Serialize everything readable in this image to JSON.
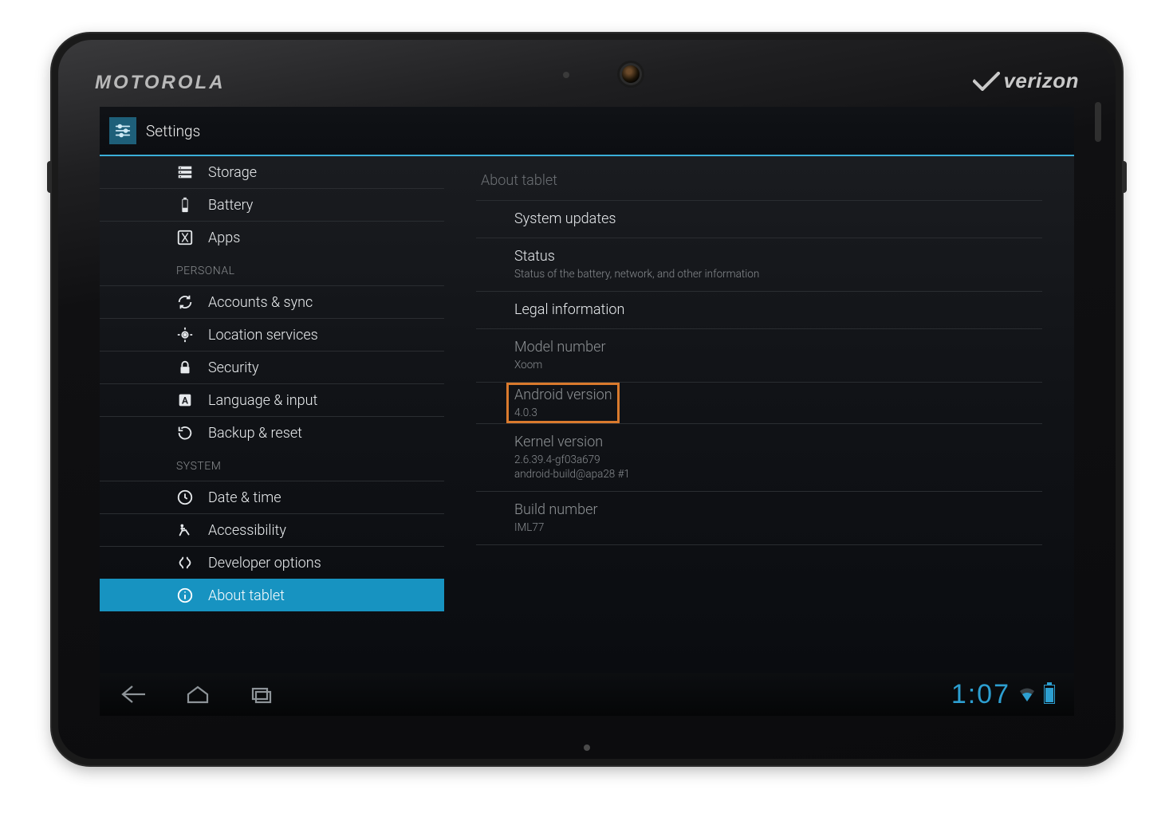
{
  "device": {
    "brand_left": "MOTOROLA",
    "brand_right": "verizon"
  },
  "header": {
    "title": "Settings"
  },
  "sidebar": {
    "items_top": [
      {
        "icon": "storage-icon",
        "label": "Storage"
      },
      {
        "icon": "battery-icon",
        "label": "Battery"
      },
      {
        "icon": "apps-icon",
        "label": "Apps"
      }
    ],
    "cat_personal": "PERSONAL",
    "items_personal": [
      {
        "icon": "sync-icon",
        "label": "Accounts & sync"
      },
      {
        "icon": "location-icon",
        "label": "Location services"
      },
      {
        "icon": "lock-icon",
        "label": "Security"
      },
      {
        "icon": "language-icon",
        "label": "Language & input"
      },
      {
        "icon": "backup-icon",
        "label": "Backup & reset"
      }
    ],
    "cat_system": "SYSTEM",
    "items_system": [
      {
        "icon": "clock-icon",
        "label": "Date & time"
      },
      {
        "icon": "accessibility-icon",
        "label": "Accessibility"
      },
      {
        "icon": "developer-icon",
        "label": "Developer options"
      },
      {
        "icon": "info-icon",
        "label": "About tablet",
        "selected": true
      }
    ]
  },
  "right": {
    "title": "About tablet",
    "items": [
      {
        "label": "System updates"
      },
      {
        "label": "Status",
        "sub": "Status of the battery, network, and other information"
      },
      {
        "label": "Legal information"
      },
      {
        "label": "Model number",
        "sub": "Xoom",
        "dim": true
      },
      {
        "label": "Android version",
        "sub": "4.0.3",
        "dim": true,
        "highlight": true
      },
      {
        "label": "Kernel version",
        "sub": "2.6.39.4-gf03a679\nandroid-build@apa28 #1",
        "dim": true
      },
      {
        "label": "Build number",
        "sub": "IML77",
        "dim": true
      }
    ]
  },
  "sysbar": {
    "clock": "1:07"
  }
}
